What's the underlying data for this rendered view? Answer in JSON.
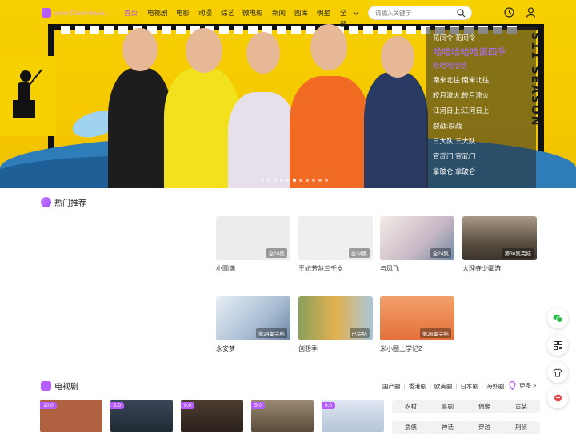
{
  "header": {
    "logo_text": "www.Diannbase...",
    "nav": [
      "首页",
      "电视剧",
      "电影",
      "动漫",
      "综艺",
      "微电影",
      "新闻",
      "图库",
      "明星",
      "全部"
    ],
    "search_placeholder": "请输入关键字"
  },
  "hero": {
    "vertical_text": "S11 SEASON",
    "list": [
      {
        "text": "花间令:花间令"
      },
      {
        "text": "哈哈哈哈哈第四季",
        "active": true,
        "sub": "哈哈哈哈哈"
      },
      {
        "text": "南来北往:南来北往"
      },
      {
        "text": "皎月流火:皎月流火"
      },
      {
        "text": "江河日上:江河日上"
      },
      {
        "text": "裂战:裂战"
      },
      {
        "text": "三大队:三大队"
      },
      {
        "text": "宣武门:宣武门"
      },
      {
        "text": "拿破仑:拿破仑"
      }
    ]
  },
  "hot": {
    "title": "热门推荐",
    "cards": [
      {
        "title": "小圆满",
        "badge": "全24集",
        "color": "#ececec"
      },
      {
        "title": "王妃芳龄三千岁",
        "badge": "全24集",
        "color": "#efefef"
      },
      {
        "title": "与凤飞",
        "badge": "全24集",
        "color": "#e9d6d0"
      },
      {
        "title": "大理寺少卿游",
        "badge": "第36集完结",
        "color": "#6a5d4f"
      },
      {
        "title": "永安梦",
        "badge": "第24集完结",
        "color": "#cfd8e2"
      },
      {
        "title": "创想季",
        "badge": "已完结",
        "color": "#d9a347"
      },
      {
        "title": "米小圈上学记2",
        "badge": "第26集完结",
        "color": "#e8874c"
      }
    ]
  },
  "tv": {
    "title": "电视剧",
    "links": [
      "国产剧",
      "香港剧",
      "欧美剧",
      "日本剧",
      "海外剧"
    ],
    "more": "更多 >",
    "posters": [
      {
        "score": "10.0",
        "color": "#b06240"
      },
      {
        "score": "2.0",
        "color": "#2f3b48"
      },
      {
        "score": "9.0",
        "color": "#3a2e27"
      },
      {
        "score": "5.0",
        "color": "#7b6a55"
      },
      {
        "score": "6.0",
        "color": "#c9d6e8"
      }
    ],
    "genres": [
      "农村",
      "喜剧",
      "偶像",
      "古装",
      "武侠",
      "神话",
      "穿越",
      "刑侦"
    ]
  }
}
